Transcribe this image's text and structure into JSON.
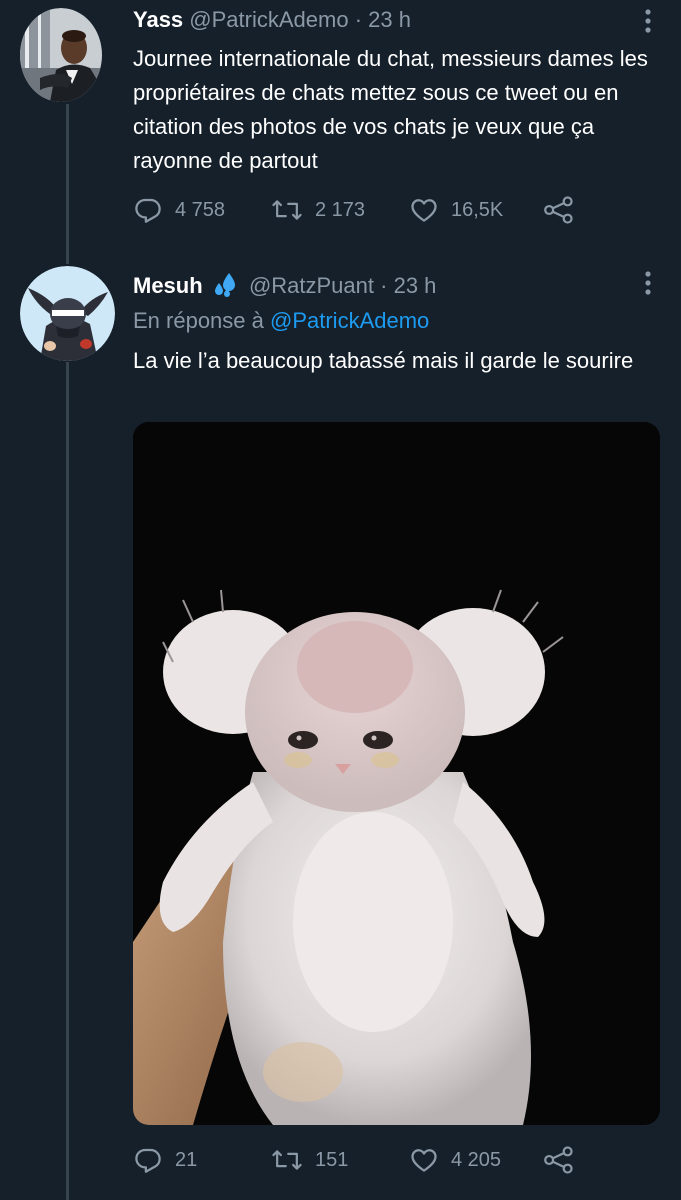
{
  "tweet1": {
    "display_name": "Yass",
    "handle": "@PatrickAdemo",
    "separator": "·",
    "time": "23 h",
    "text": "Journee internationale du chat, messieurs dames les propriétaires de chats mettez sous ce tweet ou en citation des photos de vos chats je veux que ça rayonne de partout",
    "replies": "4 758",
    "retweets": "2 173",
    "likes": "16,5K"
  },
  "tweet2": {
    "display_name": "Mesuh",
    "emoji_icon": "sweat-droplets-icon",
    "handle": "@RatzPuant",
    "separator": "·",
    "time": "23 h",
    "reply_prefix": "En réponse à",
    "reply_mention": "@PatrickAdemo",
    "text": "La vie l’a beaucoup tabassé mais il garde le sourire",
    "media": "photo of a fluffy white kitten held up by a hand against a black background",
    "replies": "21",
    "retweets": "151",
    "likes": "4 205"
  },
  "icons": [
    "more-vertical-icon",
    "reply-icon",
    "retweet-icon",
    "like-icon",
    "share-icon"
  ],
  "colors": {
    "background": "#15202b",
    "text": "#ffffff",
    "muted": "#8b98a5",
    "link": "#1d9bf0",
    "thread_line": "#38444d"
  }
}
